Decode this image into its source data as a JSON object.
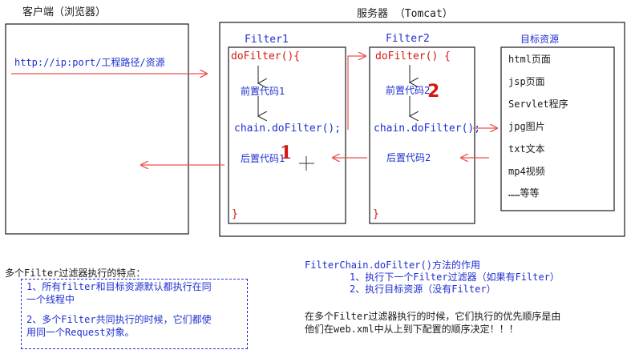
{
  "client": {
    "title": "客户端（浏览器）",
    "request_url": "http://ip:port/工程路径/资源"
  },
  "server": {
    "title": "服务器  （Tomcat）",
    "filter1": {
      "name": "Filter1",
      "method": "doFilter(){",
      "pre_code": "前置代码1",
      "chain_call": "chain.doFilter();",
      "post_code": "后置代码1",
      "close": "}"
    },
    "filter2": {
      "name": "Filter2",
      "method": "doFilter() {",
      "pre_code": "前置代码2",
      "chain_call": "chain.doFilter();",
      "post_code": "后置代码2",
      "close": "}"
    },
    "resources": {
      "title": "目标资源",
      "items": [
        "html页面",
        "jsp页面",
        "Servlet程序",
        "jpg图片",
        "txt文本",
        "mp4视频",
        "……等等"
      ]
    }
  },
  "annotations": {
    "mark1": "1",
    "mark2": "2"
  },
  "notes": {
    "features_title": "多个Filter过滤器执行的特点：",
    "feature1_line1": "1、所有filter和目标资源默认都执行在同",
    "feature1_line2": "一个线程中",
    "feature2_line1": "2、多个Filter共同执行的时候，它们都使",
    "feature2_line2": "用同一个Request对象。",
    "chain_title": "FilterChain.doFilter()方法的作用",
    "chain_item1": "1、执行下一个Filter过滤器（如果有Filter）",
    "chain_item2": "2、执行目标资源（没有Filter）",
    "order_line1": "在多个Filter过滤器执行的时候，它们执行的优先顺序是由",
    "order_line2": "他们在web.xml中从上到下配置的顺序决定！！！"
  },
  "colors": {
    "text": "#1a1a1a",
    "blue": "#1f2fd0",
    "red": "#d11a12",
    "arrow_red": "#e8544f"
  }
}
